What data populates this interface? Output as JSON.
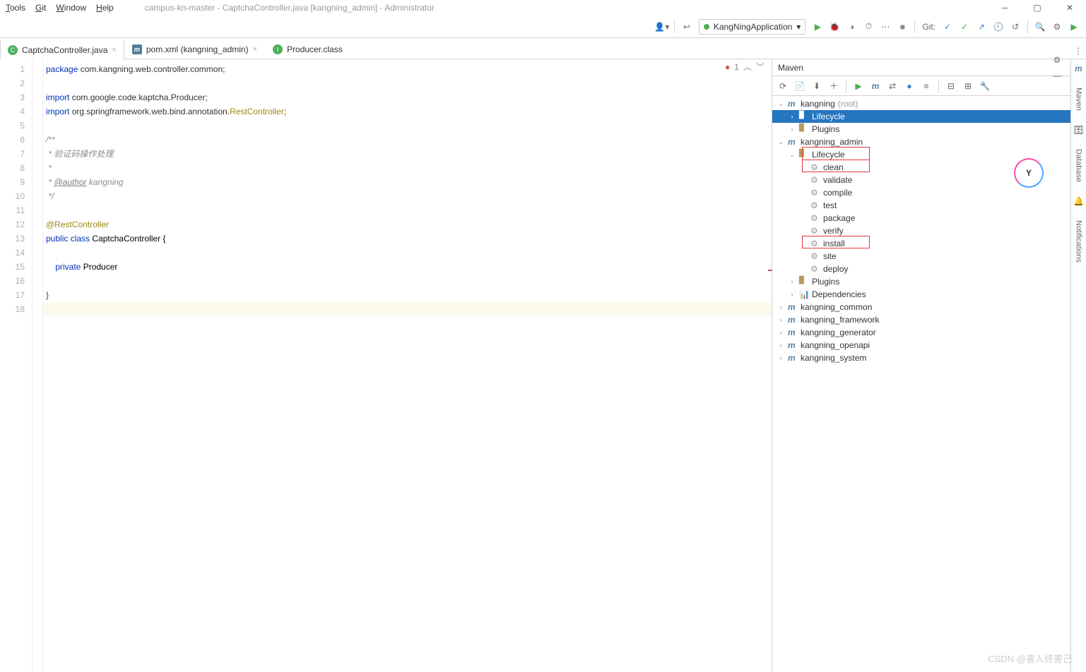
{
  "window": {
    "menu": [
      "Tools",
      "Git",
      "Window",
      "Help"
    ],
    "title": "campus-kn-master - CaptchaController.java [kangning_admin] - Administrator"
  },
  "toolbar": {
    "run_config": "KangNingApplication",
    "git_label": "Git:"
  },
  "tabs": [
    {
      "label": "CaptchaController.java",
      "icon": "java",
      "active": true
    },
    {
      "label": "pom.xml (kangning_admin)",
      "icon": "pom",
      "active": false
    },
    {
      "label": "Producer.class",
      "icon": "cls",
      "active": false
    }
  ],
  "editor": {
    "error_count": "1",
    "lines": [
      {
        "n": 1,
        "segs": [
          {
            "t": "package ",
            "c": "kw"
          },
          {
            "t": "com.kangning.web.controller.common;",
            "c": ""
          }
        ]
      },
      {
        "n": 2,
        "segs": [
          {
            "t": "",
            "c": ""
          }
        ]
      },
      {
        "n": 3,
        "segs": [
          {
            "t": "import ",
            "c": "kw"
          },
          {
            "t": "com.google.code.kaptcha.Producer;",
            "c": ""
          }
        ]
      },
      {
        "n": 4,
        "segs": [
          {
            "t": "import ",
            "c": "kw"
          },
          {
            "t": "org.springframework.web.bind.annotation.",
            "c": ""
          },
          {
            "t": "RestController",
            "c": "ann"
          },
          {
            "t": ";",
            "c": ""
          }
        ]
      },
      {
        "n": 5,
        "segs": [
          {
            "t": "",
            "c": ""
          }
        ]
      },
      {
        "n": 6,
        "segs": [
          {
            "t": "/**",
            "c": "com"
          }
        ]
      },
      {
        "n": 7,
        "segs": [
          {
            "t": " * 验证码操作处理",
            "c": "com"
          }
        ]
      },
      {
        "n": 8,
        "segs": [
          {
            "t": " *",
            "c": "com"
          }
        ]
      },
      {
        "n": 9,
        "segs": [
          {
            "t": " * ",
            "c": "com"
          },
          {
            "t": "@author",
            "c": "tag"
          },
          {
            "t": " kangning",
            "c": "com"
          }
        ]
      },
      {
        "n": 10,
        "segs": [
          {
            "t": " */",
            "c": "com"
          }
        ]
      },
      {
        "n": 11,
        "segs": [
          {
            "t": "",
            "c": ""
          }
        ]
      },
      {
        "n": 12,
        "segs": [
          {
            "t": "@RestController",
            "c": "ann"
          }
        ]
      },
      {
        "n": 13,
        "segs": [
          {
            "t": "public class ",
            "c": "kw"
          },
          {
            "t": "CaptchaController {",
            "c": "cls"
          }
        ]
      },
      {
        "n": 14,
        "segs": [
          {
            "t": "",
            "c": ""
          }
        ]
      },
      {
        "n": 15,
        "segs": [
          {
            "t": "    private ",
            "c": "kw"
          },
          {
            "t": "Producer",
            "c": "cls"
          }
        ]
      },
      {
        "n": 16,
        "segs": [
          {
            "t": "",
            "c": ""
          }
        ]
      },
      {
        "n": 17,
        "segs": [
          {
            "t": "}",
            "c": ""
          }
        ]
      },
      {
        "n": 18,
        "segs": [
          {
            "t": "",
            "c": ""
          }
        ],
        "cur": true
      }
    ]
  },
  "maven": {
    "title": "Maven",
    "tree": [
      {
        "d": 0,
        "arr": "v",
        "icon": "m",
        "label": "kangning",
        "hint": " (root)"
      },
      {
        "d": 1,
        "arr": ">",
        "icon": "f",
        "label": "Lifecycle",
        "sel": true
      },
      {
        "d": 1,
        "arr": ">",
        "icon": "f",
        "label": "Plugins"
      },
      {
        "d": 0,
        "arr": "v",
        "icon": "m",
        "label": "kangning_admin"
      },
      {
        "d": 1,
        "arr": "v",
        "icon": "f",
        "label": "Lifecycle"
      },
      {
        "d": 2,
        "arr": "",
        "icon": "g",
        "label": "clean",
        "box": 1
      },
      {
        "d": 2,
        "arr": "",
        "icon": "g",
        "label": "validate"
      },
      {
        "d": 2,
        "arr": "",
        "icon": "g",
        "label": "compile"
      },
      {
        "d": 2,
        "arr": "",
        "icon": "g",
        "label": "test"
      },
      {
        "d": 2,
        "arr": "",
        "icon": "g",
        "label": "package"
      },
      {
        "d": 2,
        "arr": "",
        "icon": "g",
        "label": "verify"
      },
      {
        "d": 2,
        "arr": "",
        "icon": "g",
        "label": "install",
        "box": 1
      },
      {
        "d": 2,
        "arr": "",
        "icon": "g",
        "label": "site"
      },
      {
        "d": 2,
        "arr": "",
        "icon": "g",
        "label": "deploy"
      },
      {
        "d": 1,
        "arr": ">",
        "icon": "f",
        "label": "Plugins"
      },
      {
        "d": 1,
        "arr": ">",
        "icon": "d",
        "label": "Dependencies"
      },
      {
        "d": 0,
        "arr": ">",
        "icon": "m",
        "label": "kangning_common"
      },
      {
        "d": 0,
        "arr": ">",
        "icon": "m",
        "label": "kangning_framework"
      },
      {
        "d": 0,
        "arr": ">",
        "icon": "m",
        "label": "kangning_generator"
      },
      {
        "d": 0,
        "arr": ">",
        "icon": "m",
        "label": "kangning_openapi"
      },
      {
        "d": 0,
        "arr": ">",
        "icon": "m",
        "label": "kangning_system"
      }
    ]
  },
  "sidestrip": [
    "Maven",
    "Database",
    "Notifications"
  ],
  "watermark": "CSDN @害人终害己"
}
